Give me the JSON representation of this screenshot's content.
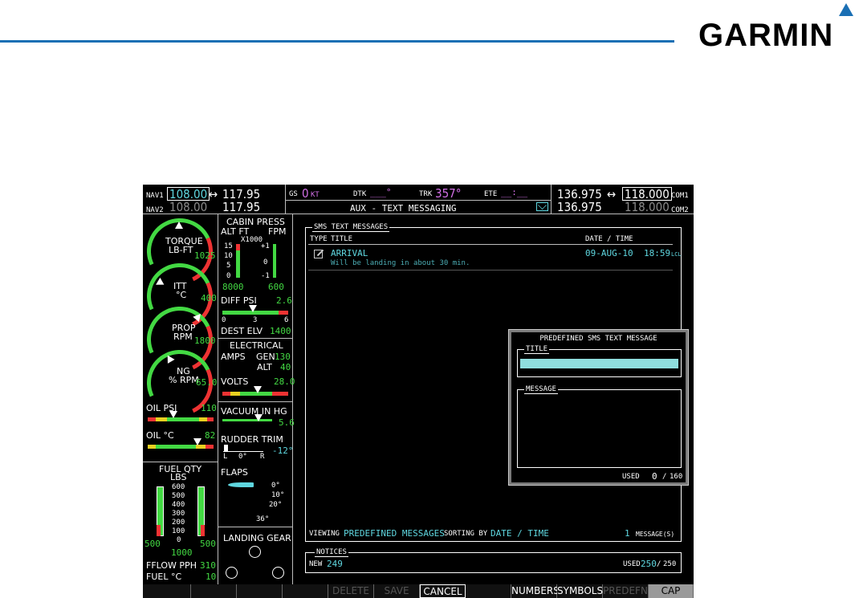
{
  "brand": {
    "logo_text": "GARMIN",
    "accent": "#1a6fb4"
  },
  "nav": {
    "nav1_label": "NAV1",
    "nav1_active": "108.00",
    "nav1_standby": "117.95",
    "nav2_label": "NAV2",
    "nav2_active": "108.00",
    "nav2_standby": "117.95",
    "swap_glyph": "↔"
  },
  "status": {
    "gs_label": "GS",
    "gs_value": "0",
    "gs_unit": "KT",
    "dtk_label": "DTK",
    "dtk_value": "___°",
    "trk_label": "TRK",
    "trk_value": "357°",
    "ete_label": "ETE",
    "ete_value": "__:__",
    "page_title": "AUX - TEXT MESSAGING",
    "mail_icon": "envelope-icon"
  },
  "com": {
    "com1_standby": "136.975",
    "com1_active": "118.000",
    "com1_label": "COM1",
    "com2_standby": "136.975",
    "com2_active": "118.000",
    "com2_label": "COM2"
  },
  "engine": {
    "torque_label1": "TORQUE",
    "torque_label2": "LB-FT",
    "torque_value": "1025",
    "itt_label1": "ITT",
    "itt_label2": "°C",
    "itt_value": "400",
    "prop_label1": "PROP",
    "prop_label2": "RPM",
    "prop_value": "1800",
    "ng_label1": "NG",
    "ng_label2": "% RPM",
    "ng_value": "65.0",
    "oil_psi_label": "OIL PSI",
    "oil_psi_value": "110",
    "oil_c_label": "OIL °C",
    "oil_c_value": "82",
    "fuel_qty_label1": "FUEL QTY",
    "fuel_qty_label2": "LBS",
    "fuel_scale": [
      "600",
      "500",
      "400",
      "300",
      "200",
      "100",
      "0"
    ],
    "fuel_left": "500",
    "fuel_right": "500",
    "fuel_total": "1000",
    "fflow_label": "FFLOW PPH",
    "fflow_value": "310",
    "fuel_temp_label": "FUEL °C",
    "fuel_temp_value": "10"
  },
  "systems": {
    "cabin_label": "CABIN PRESS",
    "alt_ft": "ALT FT",
    "fpm": "FPM",
    "x1000": "X1000",
    "alt_scale": [
      "15",
      "10",
      "5",
      "0"
    ],
    "fpm_scale": [
      "+1",
      "0",
      "-1"
    ],
    "alt_value": "8000",
    "fpm_value": "600",
    "diff_label": "DIFF PSI",
    "diff_value": "2.6",
    "diff_scale": [
      "0",
      "3",
      "6"
    ],
    "dest_label": "DEST ELV",
    "dest_value": "1400",
    "electrical_label": "ELECTRICAL",
    "amps_label": "AMPS",
    "gen_label": "GEN",
    "gen_value": "130",
    "alt_label": "ALT",
    "alt_amp_value": "40",
    "volts_label": "VOLTS",
    "volts_value": "28.0",
    "vacuum_label": "VACUUM IN HG",
    "vacuum_value": "5.6",
    "rudder_label": "RUDDER TRIM",
    "rudder_value": "-12°",
    "rudder_scale": [
      "L",
      "0°",
      "R"
    ],
    "flaps_label": "FLAPS",
    "flaps_scale": [
      "0°",
      "10°",
      "20°",
      "36°"
    ],
    "gear_label": "LANDING GEAR"
  },
  "sms": {
    "panel_label": "SMS TEXT MESSAGES",
    "col_type": "TYPE",
    "col_title": "TITLE",
    "col_date": "DATE / TIME",
    "messages": [
      {
        "icon": "note-edit-icon",
        "title": "ARRIVAL",
        "body": "Will be landing in about 30 min.",
        "date": "09-AUG-10",
        "time": "18:59",
        "tz": "LCL"
      }
    ],
    "viewing_label": "VIEWING",
    "viewing_value": "PREDEFINED MESSAGES",
    "sorting_label": "SORTING BY",
    "sorting_value": "DATE / TIME",
    "count_value": "1",
    "count_label": "MESSAGE(S)"
  },
  "notices": {
    "label": "NOTICES",
    "new_label": "NEW",
    "new_value": "249",
    "used_label": "USED",
    "used_value": "250",
    "used_max": "250"
  },
  "popup": {
    "title": "PREDEFINED SMS TEXT MESSAGE",
    "title_label": "TITLE",
    "title_value": "",
    "message_label": "MESSAGE",
    "message_value": "",
    "used_label": "USED",
    "used_value": "0",
    "used_max": "160"
  },
  "softkeys": [
    {
      "label": "",
      "state": "blank"
    },
    {
      "label": "",
      "state": "blank"
    },
    {
      "label": "",
      "state": "blank"
    },
    {
      "label": "",
      "state": "blank"
    },
    {
      "label": "DELETE",
      "state": "disabled"
    },
    {
      "label": "SAVE",
      "state": "disabled"
    },
    {
      "label": "CANCEL",
      "state": "active"
    },
    {
      "label": "",
      "state": "blank"
    },
    {
      "label": "NUMBERS",
      "state": "enabled"
    },
    {
      "label": "SYMBOLS",
      "state": "enabled"
    },
    {
      "label": "PREDEFN",
      "state": "disabled"
    },
    {
      "label": "CAP LOCK",
      "state": "selected"
    }
  ]
}
